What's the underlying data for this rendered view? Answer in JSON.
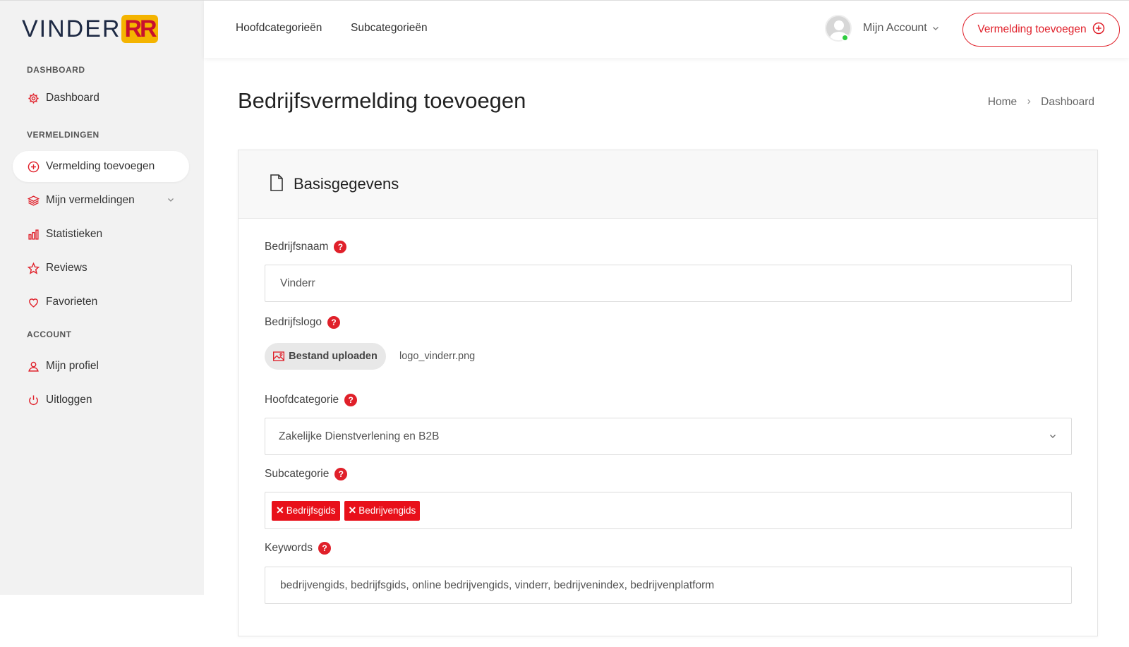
{
  "brand": {
    "logo_text": "VINDER",
    "logo_mark": "RR"
  },
  "sidebar": {
    "sections": [
      {
        "label": "DASHBOARD"
      },
      {
        "label": "VERMELDINGEN"
      },
      {
        "label": "ACCOUNT"
      }
    ],
    "items": [
      {
        "label": "Dashboard",
        "icon": "gear-icon"
      },
      {
        "label": "Vermelding toevoegen",
        "icon": "plus-circle-icon",
        "active": true
      },
      {
        "label": "Mijn vermeldingen",
        "icon": "layers-icon"
      },
      {
        "label": "Statistieken",
        "icon": "bar-chart-icon"
      },
      {
        "label": "Reviews",
        "icon": "star-icon"
      },
      {
        "label": "Favorieten",
        "icon": "heart-icon"
      },
      {
        "label": "Mijn profiel",
        "icon": "user-icon"
      },
      {
        "label": "Uitloggen",
        "icon": "power-icon"
      }
    ]
  },
  "topbar": {
    "nav": [
      {
        "label": "Hoofdcategorieën"
      },
      {
        "label": "Subcategorieën"
      }
    ],
    "account_label": "Mijn Account",
    "cta_label": "Vermelding toevoegen"
  },
  "page": {
    "title": "Bedrijfsvermelding toevoegen",
    "breadcrumb": [
      "Home",
      "Dashboard"
    ]
  },
  "form": {
    "section_title": "Basisgegevens",
    "company_name": {
      "label": "Bedrijfsnaam",
      "value": "Vinderr"
    },
    "company_logo": {
      "label": "Bedrijfslogo",
      "button": "Bestand uploaden",
      "file": "logo_vinderr.png"
    },
    "main_category": {
      "label": "Hoofdcategorie",
      "value": "Zakelijke Dienstverlening en B2B"
    },
    "subcategory": {
      "label": "Subcategorie",
      "tags": [
        "Bedrijfsgids",
        "Bedrijvengids"
      ]
    },
    "keywords": {
      "label": "Keywords",
      "value": "bedrijvengids, bedrijfsgids, online bedrijvengids, vinderr, bedrijvenindex, bedrijvenplatform"
    },
    "help_mark": "?"
  },
  "colors": {
    "accent": "#e0202a",
    "logo_bg": "#f4b400",
    "navy": "#1e2a44"
  }
}
